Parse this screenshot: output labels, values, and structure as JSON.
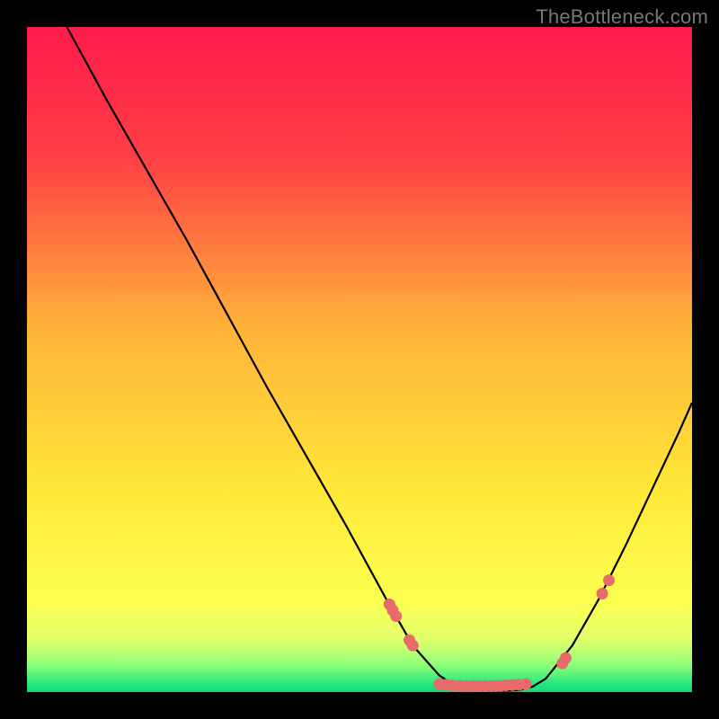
{
  "watermark": "TheBottleneck.com",
  "chart_data": {
    "type": "line",
    "title": "",
    "xlabel": "",
    "ylabel": "",
    "xlim": [
      0,
      100
    ],
    "ylim": [
      0,
      100
    ],
    "curve": {
      "name": "bottleneck-curve",
      "x": [
        6,
        12,
        18,
        24,
        30,
        36,
        42,
        48,
        54,
        58,
        62,
        64,
        66,
        68,
        70,
        72,
        74,
        76,
        78,
        82,
        86,
        90,
        94,
        98,
        100
      ],
      "y": [
        100,
        89,
        78.5,
        68,
        57,
        46,
        35.5,
        25,
        14,
        7,
        2.5,
        1.2,
        0.6,
        0.3,
        0.2,
        0.2,
        0.3,
        0.8,
        2,
        7,
        14,
        22,
        30.5,
        39,
        43.5
      ]
    },
    "dots": [
      {
        "x": 54.5,
        "y": 13.2
      },
      {
        "x": 55.0,
        "y": 12.3
      },
      {
        "x": 55.5,
        "y": 11.4
      },
      {
        "x": 57.5,
        "y": 7.8
      },
      {
        "x": 58.0,
        "y": 7.0
      },
      {
        "x": 62.0,
        "y": 1.2
      },
      {
        "x": 63.0,
        "y": 1.1
      },
      {
        "x": 64.0,
        "y": 1.0
      },
      {
        "x": 65.0,
        "y": 0.95
      },
      {
        "x": 66.0,
        "y": 0.9
      },
      {
        "x": 67.0,
        "y": 0.9
      },
      {
        "x": 68.0,
        "y": 0.9
      },
      {
        "x": 69.0,
        "y": 0.9
      },
      {
        "x": 69.8,
        "y": 0.9
      },
      {
        "x": 70.5,
        "y": 0.9
      },
      {
        "x": 71.2,
        "y": 0.95
      },
      {
        "x": 72.0,
        "y": 1.0
      },
      {
        "x": 73.0,
        "y": 1.05
      },
      {
        "x": 74.0,
        "y": 1.1
      },
      {
        "x": 75.0,
        "y": 1.2
      },
      {
        "x": 80.5,
        "y": 4.3
      },
      {
        "x": 81.0,
        "y": 5.1
      },
      {
        "x": 86.5,
        "y": 14.8
      },
      {
        "x": 87.5,
        "y": 16.8
      }
    ],
    "gradient_stops": [
      {
        "offset": 0,
        "color": "#ff1a4d"
      },
      {
        "offset": 20,
        "color": "#ff4044"
      },
      {
        "offset": 45,
        "color": "#ffb23a"
      },
      {
        "offset": 70,
        "color": "#ffe838"
      },
      {
        "offset": 86,
        "color": "#fdff51"
      },
      {
        "offset": 92,
        "color": "#e3ff6a"
      },
      {
        "offset": 96,
        "color": "#8cff7a"
      },
      {
        "offset": 99,
        "color": "#21e67e"
      },
      {
        "offset": 100,
        "color": "#11d877"
      }
    ],
    "dot_color": "#e86a6a",
    "line_color": "#000000"
  }
}
